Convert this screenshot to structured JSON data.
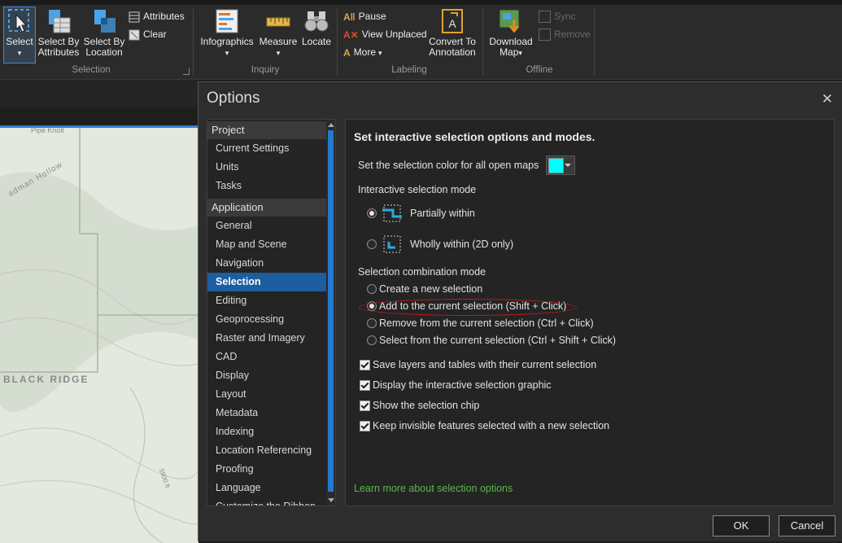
{
  "ribbon": {
    "selection_group": {
      "label": "Selection",
      "select": "Select",
      "select_by_attributes": [
        "Select By",
        "Attributes"
      ],
      "select_by_location": [
        "Select By",
        "Location"
      ],
      "attributes": "Attributes",
      "clear": "Clear"
    },
    "inquiry_group": {
      "label": "Inquiry",
      "infographics": "Infographics",
      "measure": "Measure",
      "locate": "Locate"
    },
    "labeling_group": {
      "label": "Labeling",
      "pause": "Pause",
      "view_unplaced": "View Unplaced",
      "more": "More",
      "convert_to_annotation": [
        "Convert To",
        "Annotation"
      ]
    },
    "offline_group": {
      "label": "Offline",
      "download_map": [
        "Download",
        "Map"
      ],
      "sync": "Sync",
      "remove": "Remove"
    }
  },
  "map": {
    "labels": [
      "Pipe Knoll",
      "adman Hollow",
      "BLACK RIDGE",
      "5900 ft"
    ]
  },
  "dialog": {
    "title": "Options",
    "close": "✕",
    "nav": {
      "project_header": "Project",
      "project_items": [
        "Current Settings",
        "Units",
        "Tasks"
      ],
      "application_header": "Application",
      "application_items": [
        "General",
        "Map and Scene",
        "Navigation",
        "Selection",
        "Editing",
        "Geoprocessing",
        "Raster and Imagery",
        "CAD",
        "Display",
        "Layout",
        "Metadata",
        "Indexing",
        "Location Referencing",
        "Proofing",
        "Language",
        "Customize the Ribbon"
      ],
      "selected": "Selection"
    },
    "content": {
      "heading": "Set interactive selection options and modes.",
      "color_label": "Set the selection color for all open maps",
      "selection_color": "#00ffff",
      "mode_label": "Interactive selection mode",
      "mode_options": [
        "Partially within",
        "Wholly within (2D only)"
      ],
      "mode_selected": 0,
      "combo_label": "Selection combination mode",
      "combo_options": [
        "Create a new selection",
        "Add to the current selection (Shift + Click)",
        "Remove from the current selection (Ctrl + Click)",
        "Select from the current selection (Ctrl + Shift + Click)"
      ],
      "combo_selected": 1,
      "checkboxes": [
        "Save layers and tables with their current selection",
        "Display the interactive selection graphic",
        "Show the selection chip",
        "Keep invisible features selected with a new selection"
      ],
      "learn_more": "Learn more about selection options"
    },
    "ok": "OK",
    "cancel": "Cancel"
  },
  "colors": {
    "accent": "#1d5e9f",
    "link": "#57b848",
    "annotation": "#c8171c"
  }
}
